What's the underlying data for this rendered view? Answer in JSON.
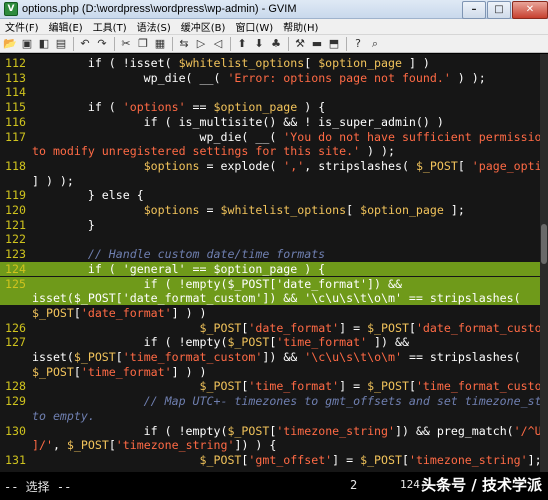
{
  "window": {
    "title": "options.php (D:\\wordpress\\wordpress\\wp-admin) - GVIM",
    "app_icon_letter": "V",
    "buttons": {
      "minimize": "–",
      "maximize": "□",
      "close": "✕"
    }
  },
  "menu": [
    "文件(F)",
    "编辑(E)",
    "工具(T)",
    "语法(S)",
    "缓冲区(B)",
    "窗口(W)",
    "帮助(H)"
  ],
  "toolbar": {
    "groups": [
      [
        "open-icon",
        "save-icon",
        "save-all-icon",
        "print-icon"
      ],
      [
        "undo-icon",
        "redo-icon"
      ],
      [
        "cut-icon",
        "copy-icon",
        "paste-icon"
      ],
      [
        "replace-icon",
        "find-next-icon",
        "find-prev-icon"
      ],
      [
        "load-session-icon",
        "save-session-icon",
        "run-script-icon"
      ],
      [
        "make-icon",
        "shell-icon",
        "tags-icon"
      ],
      [
        "help-icon",
        "find-help-icon"
      ]
    ],
    "glyphs": {
      "open-icon": "📂",
      "save-icon": "▣",
      "save-all-icon": "◧",
      "print-icon": "▤",
      "undo-icon": "↶",
      "redo-icon": "↷",
      "cut-icon": "✂",
      "copy-icon": "❐",
      "paste-icon": "▦",
      "replace-icon": "⇆",
      "find-next-icon": "▷",
      "find-prev-icon": "◁",
      "load-session-icon": "⬆",
      "save-session-icon": "⬇",
      "run-script-icon": "♣",
      "make-icon": "⚒",
      "shell-icon": "▬",
      "tags-icon": "⬒",
      "help-icon": "?",
      "find-help-icon": "⌕"
    }
  },
  "editor": {
    "lines": [
      {
        "n": "112",
        "hl": false,
        "parts": [
          [
            "        if ( !isset( ",
            "kw"
          ],
          [
            "$whitelist_options",
            "var"
          ],
          [
            "[ ",
            "kw"
          ],
          [
            "$option_page",
            "var"
          ],
          [
            " ] )",
            "kw"
          ]
        ]
      },
      {
        "n": "113",
        "hl": false,
        "parts": [
          [
            "                wp_die( __( ",
            "kw"
          ],
          [
            "'Error: options page not found.'",
            "str"
          ],
          [
            " ) );",
            "kw"
          ]
        ]
      },
      {
        "n": "114",
        "hl": false,
        "parts": []
      },
      {
        "n": "115",
        "hl": false,
        "parts": [
          [
            "        if ( ",
            "kw"
          ],
          [
            "'options'",
            "str"
          ],
          [
            " == ",
            "kw"
          ],
          [
            "$option_page",
            "var"
          ],
          [
            " ) {",
            "kw"
          ]
        ]
      },
      {
        "n": "116",
        "hl": false,
        "parts": [
          [
            "                if ( is_multisite() && ! is_super_admin() )",
            "kw"
          ]
        ]
      },
      {
        "n": "117",
        "hl": false,
        "parts": [
          [
            "                        wp_die( __( ",
            "kw"
          ],
          [
            "'You do not have sufficient permissions",
            "str"
          ]
        ]
      },
      {
        "n": "",
        "hl": false,
        "parts": [
          [
            "to modify unregistered settings for this site.'",
            "str"
          ],
          [
            " ) );",
            "kw"
          ]
        ]
      },
      {
        "n": "118",
        "hl": false,
        "parts": [
          [
            "                ",
            "kw"
          ],
          [
            "$options",
            "var"
          ],
          [
            " = explode( ",
            "kw"
          ],
          [
            "','",
            "str"
          ],
          [
            ", stripslashes( ",
            "kw"
          ],
          [
            "$_POST",
            "var"
          ],
          [
            "[ ",
            "kw"
          ],
          [
            "'page_options'",
            "str"
          ]
        ]
      },
      {
        "n": "",
        "hl": false,
        "parts": [
          [
            "] ) );",
            "kw"
          ]
        ]
      },
      {
        "n": "119",
        "hl": false,
        "parts": [
          [
            "        } else {",
            "kw"
          ]
        ]
      },
      {
        "n": "120",
        "hl": false,
        "parts": [
          [
            "                ",
            "kw"
          ],
          [
            "$options",
            "var"
          ],
          [
            " = ",
            "kw"
          ],
          [
            "$whitelist_options",
            "var"
          ],
          [
            "[ ",
            "kw"
          ],
          [
            "$option_page",
            "var"
          ],
          [
            " ];",
            "kw"
          ]
        ]
      },
      {
        "n": "121",
        "hl": false,
        "parts": [
          [
            "        }",
            "kw"
          ]
        ]
      },
      {
        "n": "122",
        "hl": false,
        "parts": []
      },
      {
        "n": "123",
        "hl": false,
        "parts": [
          [
            "        // Handle custom date/time formats",
            "cmt"
          ]
        ]
      },
      {
        "n": "124",
        "hl": true,
        "parts": [
          [
            "        if ( 'general' == $option_page ) {",
            "kw"
          ]
        ]
      },
      {
        "n": "125",
        "hl": true,
        "parts": [
          [
            "                if ( !empty($_POST['date_format']) &&",
            "kw"
          ]
        ]
      },
      {
        "n": "",
        "hl": true,
        "parts": [
          [
            "isset($_POST['date_format_custom']) && '\\c\\u\\s\\t\\o\\m' == stripslashes(",
            "kw"
          ]
        ]
      },
      {
        "n": "",
        "hl": false,
        "parts": [
          [
            "$_POST",
            "var"
          ],
          [
            "[",
            "kw"
          ],
          [
            "'date_format'",
            "str"
          ],
          [
            "] ) )",
            "kw"
          ]
        ]
      },
      {
        "n": "126",
        "hl": false,
        "parts": [
          [
            "                        ",
            "kw"
          ],
          [
            "$_POST",
            "var"
          ],
          [
            "[",
            "kw"
          ],
          [
            "'date_format'",
            "str"
          ],
          [
            "] = ",
            "kw"
          ],
          [
            "$_POST",
            "var"
          ],
          [
            "[",
            "kw"
          ],
          [
            "'date_format_custom'",
            "str"
          ],
          [
            "];",
            "kw"
          ]
        ]
      },
      {
        "n": "127",
        "hl": false,
        "parts": [
          [
            "                if ( !empty(",
            "kw"
          ],
          [
            "$_POST",
            "var"
          ],
          [
            "[",
            "kw"
          ],
          [
            "'time_format'",
            "str"
          ],
          [
            " ]) &&",
            "kw"
          ]
        ]
      },
      {
        "n": "",
        "hl": false,
        "parts": [
          [
            "isset(",
            "kw"
          ],
          [
            "$_POST",
            "var"
          ],
          [
            "[",
            "kw"
          ],
          [
            "'time_format_custom'",
            "str"
          ],
          [
            "]) && ",
            "kw"
          ],
          [
            "'\\c\\u\\s\\t\\o\\m'",
            "str"
          ],
          [
            " == stripslashes(",
            "kw"
          ]
        ]
      },
      {
        "n": "",
        "hl": false,
        "parts": [
          [
            "$_POST",
            "var"
          ],
          [
            "[",
            "kw"
          ],
          [
            "'time_format'",
            "str"
          ],
          [
            "] ) )",
            "kw"
          ]
        ]
      },
      {
        "n": "128",
        "hl": false,
        "parts": [
          [
            "                        ",
            "kw"
          ],
          [
            "$_POST",
            "var"
          ],
          [
            "[",
            "kw"
          ],
          [
            "'time_format'",
            "str"
          ],
          [
            "] = ",
            "kw"
          ],
          [
            "$_POST",
            "var"
          ],
          [
            "[",
            "kw"
          ],
          [
            "'time_format_custom'",
            "str"
          ],
          [
            "];",
            "kw"
          ]
        ]
      },
      {
        "n": "129",
        "hl": false,
        "parts": [
          [
            "                // Map UTC+- timezones to gmt_offsets and set timezone_string",
            "cmt"
          ]
        ]
      },
      {
        "n": "",
        "hl": false,
        "parts": [
          [
            "to empty.",
            "cmt"
          ]
        ]
      },
      {
        "n": "130",
        "hl": false,
        "parts": [
          [
            "                if ( !empty(",
            "kw"
          ],
          [
            "$_POST",
            "var"
          ],
          [
            "[",
            "kw"
          ],
          [
            "'timezone_string'",
            "str"
          ],
          [
            "]) && preg_match(",
            "kw"
          ],
          [
            "'/^UTC[+-",
            "str"
          ]
        ]
      },
      {
        "n": "",
        "hl": false,
        "parts": [
          [
            "]/'",
            "str"
          ],
          [
            ", ",
            "kw"
          ],
          [
            "$_POST",
            "var"
          ],
          [
            "[",
            "kw"
          ],
          [
            "'timezone_string'",
            "str"
          ],
          [
            "]) ) {",
            "kw"
          ]
        ]
      },
      {
        "n": "131",
        "hl": false,
        "parts": [
          [
            "                        ",
            "kw"
          ],
          [
            "$_POST",
            "var"
          ],
          [
            "[",
            "kw"
          ],
          [
            "'gmt_offset'",
            "str"
          ],
          [
            "] = ",
            "kw"
          ],
          [
            "$_POST",
            "var"
          ],
          [
            "[",
            "kw"
          ],
          [
            "'timezone_string'",
            "str"
          ],
          [
            "];",
            "kw"
          ]
        ]
      }
    ]
  },
  "status": {
    "mode": "-- 选择 --",
    "selected_count": "2",
    "position": "124,1",
    "watermark": "头条号 / 技术学派"
  },
  "colors": {
    "editor_bg": "#161616",
    "line_number": "#cfc31e",
    "selection": "#6f9a1a",
    "string": "#ff6a45",
    "variable": "#f1c35b",
    "comment": "#6f7fb0"
  }
}
